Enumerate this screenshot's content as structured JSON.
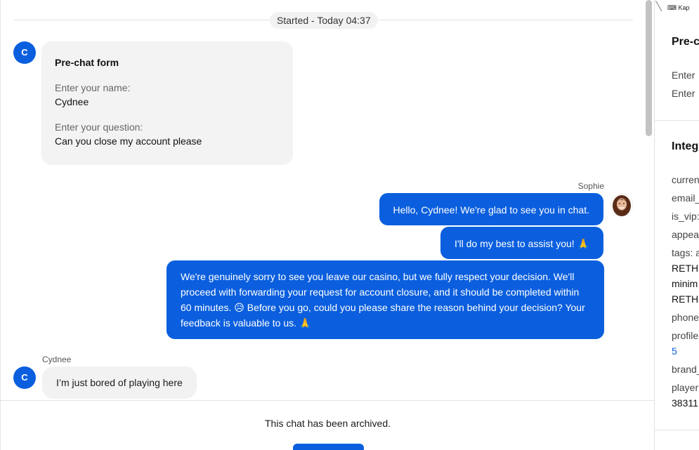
{
  "chat": {
    "started_label": "Started - Today 04:37",
    "prechat": {
      "avatar_letter": "C",
      "title": "Pre-chat form",
      "name_label": "Enter your name:",
      "name_value": "Cydnee",
      "question_label": "Enter your question:",
      "question_value": "Can you close my account please"
    },
    "agent": {
      "name": "Sophie",
      "messages": [
        "Hello, Cydnee! We're glad to see you in chat.",
        "I'll do my best to assist you! 🙏",
        "We're genuinely sorry to see you leave our casino, but we fully respect your decision. We'll proceed with forwarding your request for account closure, and it should be completed within 60 minutes. 😥 Before you go, could you please share the reason behind your decision? Your feedback is valuable to us. 🙏"
      ]
    },
    "customer": {
      "name": "Cydnee",
      "avatar_letter": "C",
      "message": "I’m just bored of playing here"
    }
  },
  "footer": {
    "archived_text": "This chat has been archived."
  },
  "sidebar": {
    "top_label": "⌨ Kap",
    "prechat_title": "Pre-c",
    "prechat_items": [
      "Enter",
      "Enter"
    ],
    "integration_title": "Integ",
    "fields": [
      "curren",
      "email_",
      "is_vip:",
      "appea",
      "tags: a",
      "RETHI",
      "minim",
      "RETHI",
      "phone",
      "profile",
      "5",
      "brand_",
      "player",
      "38311"
    ]
  },
  "colors": {
    "accent": "#0b5fde",
    "bubble_in": "#f2f2f2"
  }
}
